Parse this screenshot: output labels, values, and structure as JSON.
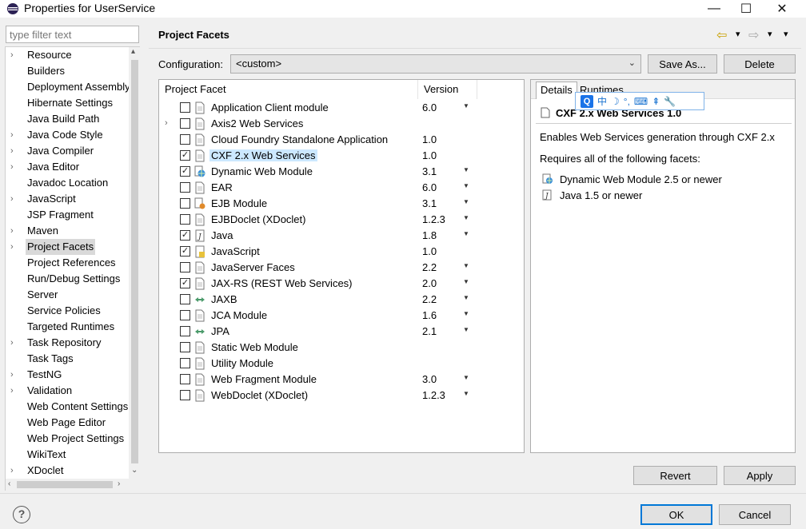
{
  "window": {
    "title": "Properties for UserService",
    "minimize": "—",
    "maximize": "☐",
    "close": "✕"
  },
  "filter": {
    "placeholder": "type filter text"
  },
  "tree": {
    "items": [
      {
        "label": "Resource",
        "expandable": true
      },
      {
        "label": "Builders",
        "expandable": false
      },
      {
        "label": "Deployment Assembly",
        "expandable": false
      },
      {
        "label": "Hibernate Settings",
        "expandable": false
      },
      {
        "label": "Java Build Path",
        "expandable": false
      },
      {
        "label": "Java Code Style",
        "expandable": true
      },
      {
        "label": "Java Compiler",
        "expandable": true
      },
      {
        "label": "Java Editor",
        "expandable": true
      },
      {
        "label": "Javadoc Location",
        "expandable": false
      },
      {
        "label": "JavaScript",
        "expandable": true
      },
      {
        "label": "JSP Fragment",
        "expandable": false
      },
      {
        "label": "Maven",
        "expandable": true
      },
      {
        "label": "Project Facets",
        "expandable": true,
        "selected": true
      },
      {
        "label": "Project References",
        "expandable": false
      },
      {
        "label": "Run/Debug Settings",
        "expandable": false
      },
      {
        "label": "Server",
        "expandable": false
      },
      {
        "label": "Service Policies",
        "expandable": false
      },
      {
        "label": "Targeted Runtimes",
        "expandable": false
      },
      {
        "label": "Task Repository",
        "expandable": true
      },
      {
        "label": "Task Tags",
        "expandable": false
      },
      {
        "label": "TestNG",
        "expandable": true
      },
      {
        "label": "Validation",
        "expandable": true
      },
      {
        "label": "Web Content Settings",
        "expandable": false
      },
      {
        "label": "Web Page Editor",
        "expandable": false
      },
      {
        "label": "Web Project Settings",
        "expandable": false
      },
      {
        "label": "WikiText",
        "expandable": false
      },
      {
        "label": "XDoclet",
        "expandable": true
      }
    ]
  },
  "header": {
    "title": "Project Facets",
    "back_icon": "⇦",
    "forward_icon": "⇨",
    "menu_icon": "▾"
  },
  "configuration": {
    "label": "Configuration:",
    "value": "<custom>",
    "save_as": "Save As...",
    "delete": "Delete"
  },
  "facets": {
    "col_facet": "Project Facet",
    "col_version": "Version",
    "rows": [
      {
        "name": "Application Client module",
        "checked": false,
        "version": "6.0",
        "dropdown": true,
        "expandable": false,
        "icon": "page"
      },
      {
        "name": "Axis2 Web Services",
        "checked": false,
        "version": "",
        "dropdown": false,
        "expandable": true,
        "icon": "page"
      },
      {
        "name": "Cloud Foundry Standalone Application",
        "checked": false,
        "version": "1.0",
        "dropdown": false,
        "expandable": false,
        "icon": "page"
      },
      {
        "name": "CXF 2.x Web Services",
        "checked": true,
        "version": "1.0",
        "dropdown": false,
        "expandable": false,
        "icon": "page",
        "selected": true
      },
      {
        "name": "Dynamic Web Module",
        "checked": true,
        "version": "3.1",
        "dropdown": true,
        "expandable": false,
        "icon": "globe"
      },
      {
        "name": "EAR",
        "checked": false,
        "version": "6.0",
        "dropdown": true,
        "expandable": false,
        "icon": "page"
      },
      {
        "name": "EJB Module",
        "checked": false,
        "version": "3.1",
        "dropdown": true,
        "expandable": false,
        "icon": "bean"
      },
      {
        "name": "EJBDoclet (XDoclet)",
        "checked": false,
        "version": "1.2.3",
        "dropdown": true,
        "expandable": false,
        "icon": "page"
      },
      {
        "name": "Java",
        "checked": true,
        "version": "1.8",
        "dropdown": true,
        "expandable": false,
        "icon": "java"
      },
      {
        "name": "JavaScript",
        "checked": true,
        "version": "1.0",
        "dropdown": false,
        "expandable": false,
        "icon": "js"
      },
      {
        "name": "JavaServer Faces",
        "checked": false,
        "version": "2.2",
        "dropdown": true,
        "expandable": false,
        "icon": "page"
      },
      {
        "name": "JAX-RS (REST Web Services)",
        "checked": true,
        "version": "2.0",
        "dropdown": true,
        "expandable": false,
        "icon": "page"
      },
      {
        "name": "JAXB",
        "checked": false,
        "version": "2.2",
        "dropdown": true,
        "expandable": false,
        "icon": "arrows"
      },
      {
        "name": "JCA Module",
        "checked": false,
        "version": "1.6",
        "dropdown": true,
        "expandable": false,
        "icon": "page"
      },
      {
        "name": "JPA",
        "checked": false,
        "version": "2.1",
        "dropdown": true,
        "expandable": false,
        "icon": "arrows"
      },
      {
        "name": "Static Web Module",
        "checked": false,
        "version": "",
        "dropdown": false,
        "expandable": false,
        "icon": "page"
      },
      {
        "name": "Utility Module",
        "checked": false,
        "version": "",
        "dropdown": false,
        "expandable": false,
        "icon": "page"
      },
      {
        "name": "Web Fragment Module",
        "checked": false,
        "version": "3.0",
        "dropdown": true,
        "expandable": false,
        "icon": "page"
      },
      {
        "name": "WebDoclet (XDoclet)",
        "checked": false,
        "version": "1.2.3",
        "dropdown": true,
        "expandable": false,
        "icon": "page"
      }
    ]
  },
  "details": {
    "tab_details": "Details",
    "tab_runtimes": "Runtimes",
    "heading": "CXF 2.x Web Services 1.0",
    "description": "Enables Web Services generation through CXF 2.x",
    "requires": "Requires all of the following facets:",
    "requirements": [
      {
        "text": "Dynamic Web Module 2.5 or newer",
        "icon": "globe"
      },
      {
        "text": "Java 1.5 or newer",
        "icon": "java"
      }
    ]
  },
  "ime": {
    "q": "Q",
    "zh": "中",
    "moon": "☽",
    "punct": "°,",
    "keyboard": "⌨",
    "voice": "⇞",
    "tools": "🔧"
  },
  "buttons": {
    "revert": "Revert",
    "apply": "Apply",
    "ok": "OK",
    "cancel": "Cancel",
    "help": "?"
  },
  "colors": {
    "selection": "#cce8ff",
    "accent": "#0078d7"
  }
}
